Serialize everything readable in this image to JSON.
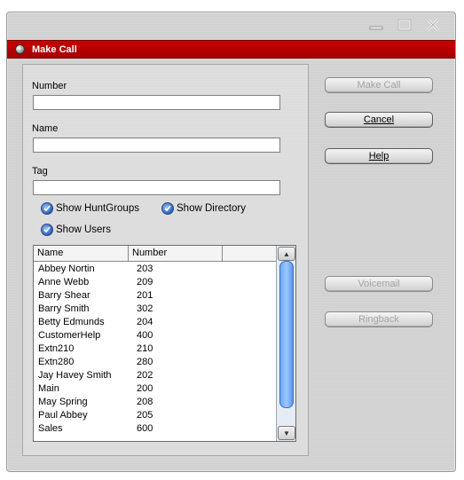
{
  "window": {
    "title": "Make Call"
  },
  "fields": {
    "number_label": "Number",
    "number_value": "",
    "name_label": "Name",
    "name_value": "",
    "tag_label": "Tag",
    "tag_value": ""
  },
  "options": {
    "show_huntgroups": "Show HuntGroups",
    "show_directory": "Show Directory",
    "show_users": "Show Users"
  },
  "list": {
    "columns": [
      "Name",
      "Number",
      ""
    ],
    "rows": [
      [
        "Abbey Nortin",
        "203"
      ],
      [
        "Anne Webb",
        "209"
      ],
      [
        "Barry Shear",
        "201"
      ],
      [
        "Barry Smith",
        "302"
      ],
      [
        "Betty Edmunds",
        "204"
      ],
      [
        "CustomerHelp",
        "400"
      ],
      [
        "Extn210",
        "210"
      ],
      [
        "Extn280",
        "280"
      ],
      [
        "Jay Havey Smith",
        "202"
      ],
      [
        "Main",
        "200"
      ],
      [
        "May Spring",
        "208"
      ],
      [
        "Paul Abbey",
        "205"
      ],
      [
        "Sales",
        "600"
      ]
    ]
  },
  "buttons": {
    "make_call": "Make Call",
    "cancel": "Cancel",
    "help": "Help",
    "voicemail": "Voicemail",
    "ringback": "Ringback"
  },
  "colors": {
    "title_bar": "#b30000",
    "check_accent": "#2b5fb5"
  },
  "icons": [
    "minimize-icon",
    "maximize-icon",
    "close-icon",
    "window-menu-icon",
    "checkmark-icon",
    "scroll-up-icon",
    "scroll-down-icon"
  ]
}
